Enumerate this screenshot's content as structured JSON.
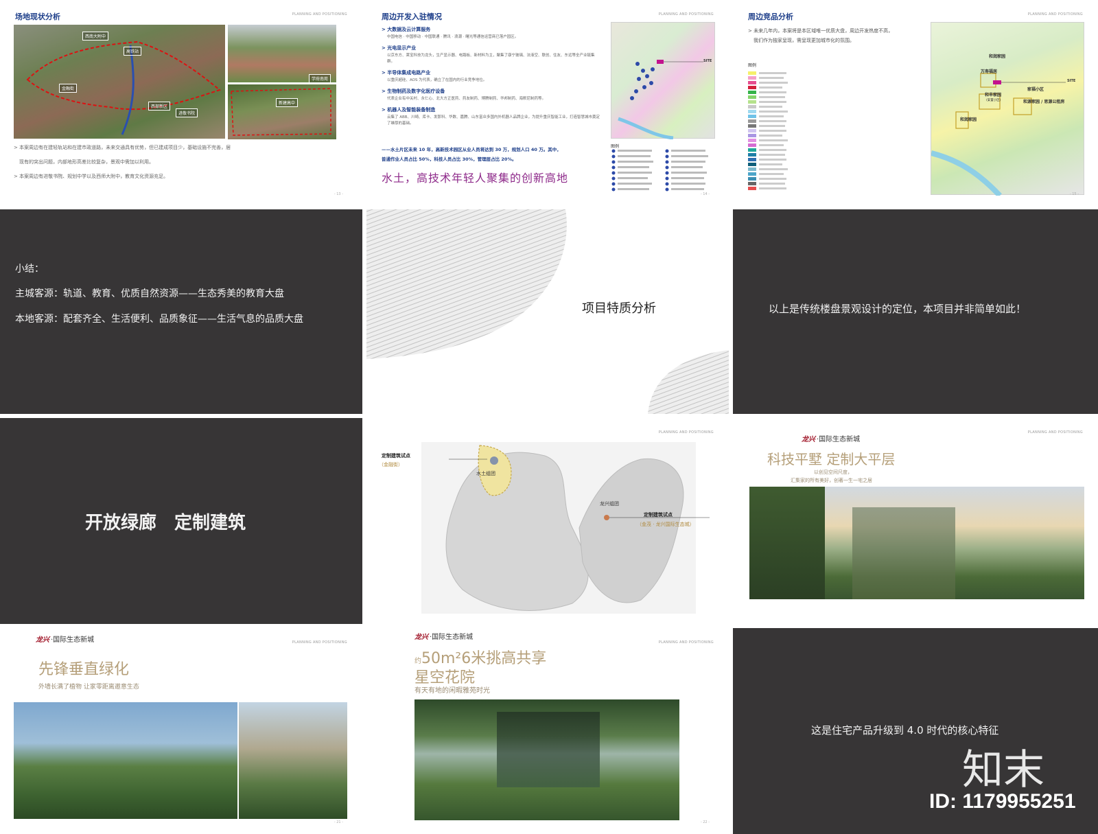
{
  "slide1": {
    "title": "场地现状分析",
    "header_tag": "PLANNING AND POSITIONING",
    "labels": [
      "西南大附中",
      "高铁站",
      "金融街",
      "西部新区",
      "进敬书院",
      "新建高中",
      "学府南苑"
    ],
    "para1_line1": "> 本案周边有在建轻轨站和在建市政道路，未来交通具有优势，但已建成项目少，基础设施不完善，居",
    "para1_line2": "现有的突出问题，内部地形高差比较复杂，景观中需加以利用。",
    "para2": "> 本案周边有进敬书院、规划中学以及西师大附中，教育文化资源充足。",
    "page": "- 13 -"
  },
  "slide2": {
    "title": "周边开发入驻情况",
    "header_tag": "PLANNING AND POSITIONING",
    "sections": [
      {
        "head": "> 大数据及云计算服务",
        "body": "中国电信 · 中国移动 · 中国联通 · 腾讯 · 浪潮 · 曙光等通信运营商已落户园区。"
      },
      {
        "head": "> 光电显示产业",
        "body": "以京东方、莱宝科技为龙头，生产显示器、电路板、新材料为主，聚集了康宁玻璃、法液空、联创、住友、东远等全产业链集群。"
      },
      {
        "head": "> 半导体集成电路产业",
        "body": "以重庆超硅、AOS 为代表，确立了在国内的行业竞争地位。"
      },
      {
        "head": "> 生物制药及数字化医疗设备",
        "body": "代表企业有中关村、永仁心、北大方正医药、药友制药、博腾制药、华邦制药、海默尼制药等。"
      },
      {
        "head": "> 机器人及智能装备制造",
        "body": "云集了 ABB、川崎、库卡、发那科、华数、嘉腾、山东富众多国内外机器人品牌企业，为提升重庆智能工业，打造智慧城市奠定了雄厚的基础。"
      }
    ],
    "highlight_line1": "——水土片区未来 10 年，高新技术园区从业人员将达到 30 万，规划人口 40 万。其中，",
    "highlight_line2": "普通作业人员占比 50%，科技人员占比 30%，管理层占比 20%。",
    "slogan": "水土，高技术年轻人聚集的创新高地",
    "map_site": "SITE",
    "map_legend_title": "图例",
    "page": "- 14 -"
  },
  "slide3": {
    "title": "周边竞品分析",
    "header_tag": "PLANNING AND POSITIONING",
    "para_line1": "> 未来几年内，本案将是本区域唯一优质大盘，周边开发热度不高，",
    "para_line2": "我们作为独家呈现，需呈现更加城市化的氛围。",
    "legend_title": "图例",
    "map_labels": [
      "和润家园",
      "万寿福居",
      "和丰家园",
      "(安置小区)",
      "家福小区",
      "和源家园 / 思源公租房",
      "和润家园",
      "SITE"
    ],
    "page": "- 15 -"
  },
  "slide4": {
    "heading": "小结：",
    "line1": "主城客源：轨道、教育、优质自然资源——生态秀美的教育大盘",
    "line2": "本地客源：配套齐全、生活便利、品质象征——生活气息的品质大盘"
  },
  "slide5": {
    "title": "项目特质分析"
  },
  "slide6": {
    "text": "以上是传统楼盘景观设计的定位，本项目并非简单如此！"
  },
  "slide7": {
    "text": "开放绿廊　定制建筑"
  },
  "slide8": {
    "header_tag": "PLANNING AND POSITIONING",
    "point1_label": "定制建筑试点",
    "point1_sub": "（金融街）",
    "zone1": "水土组团",
    "zone2": "龙兴组团",
    "point2_label": "定制建筑试点",
    "point2_sub": "（金茂 · 龙兴国际生态城）"
  },
  "slide9": {
    "brand_mark": "龙兴",
    "brand_name": "·国际生态新城",
    "header_tag": "PLANNING AND POSITIONING",
    "headline": "科技平墅 定制大平层",
    "sub1": "以创见空间尺度，",
    "sub2": "汇集家的所有美好，创著一生一宅之居"
  },
  "slide10": {
    "brand_mark": "龙兴",
    "brand_name": "·国际生态新城",
    "header_tag": "PLANNING AND POSITIONING",
    "headline": "先锋垂直绿化",
    "sub": "外墙长满了植物 让家零距离邀意生态",
    "page": "- 21 -"
  },
  "slide11": {
    "brand_mark": "龙兴",
    "brand_name": "·国际生态新城",
    "header_tag": "PLANNING AND POSITIONING",
    "prefix": "约",
    "headline1": "50m²6米挑高共享",
    "headline2": "星空花院",
    "sub": "有天有地的闲暇雅苑时光",
    "page": "- 22 -"
  },
  "slide12": {
    "text": "这是住宅产品升级到 4.0 时代的核心特征",
    "watermark_logo": "知末",
    "watermark_id": "ID: 1179955251"
  },
  "colors": {
    "dark_panel": "#373536",
    "title_blue": "#1e3f8a",
    "slogan_purple": "#8e2a8a",
    "gold": "#b59f79",
    "brand_red": "#a1182a"
  }
}
